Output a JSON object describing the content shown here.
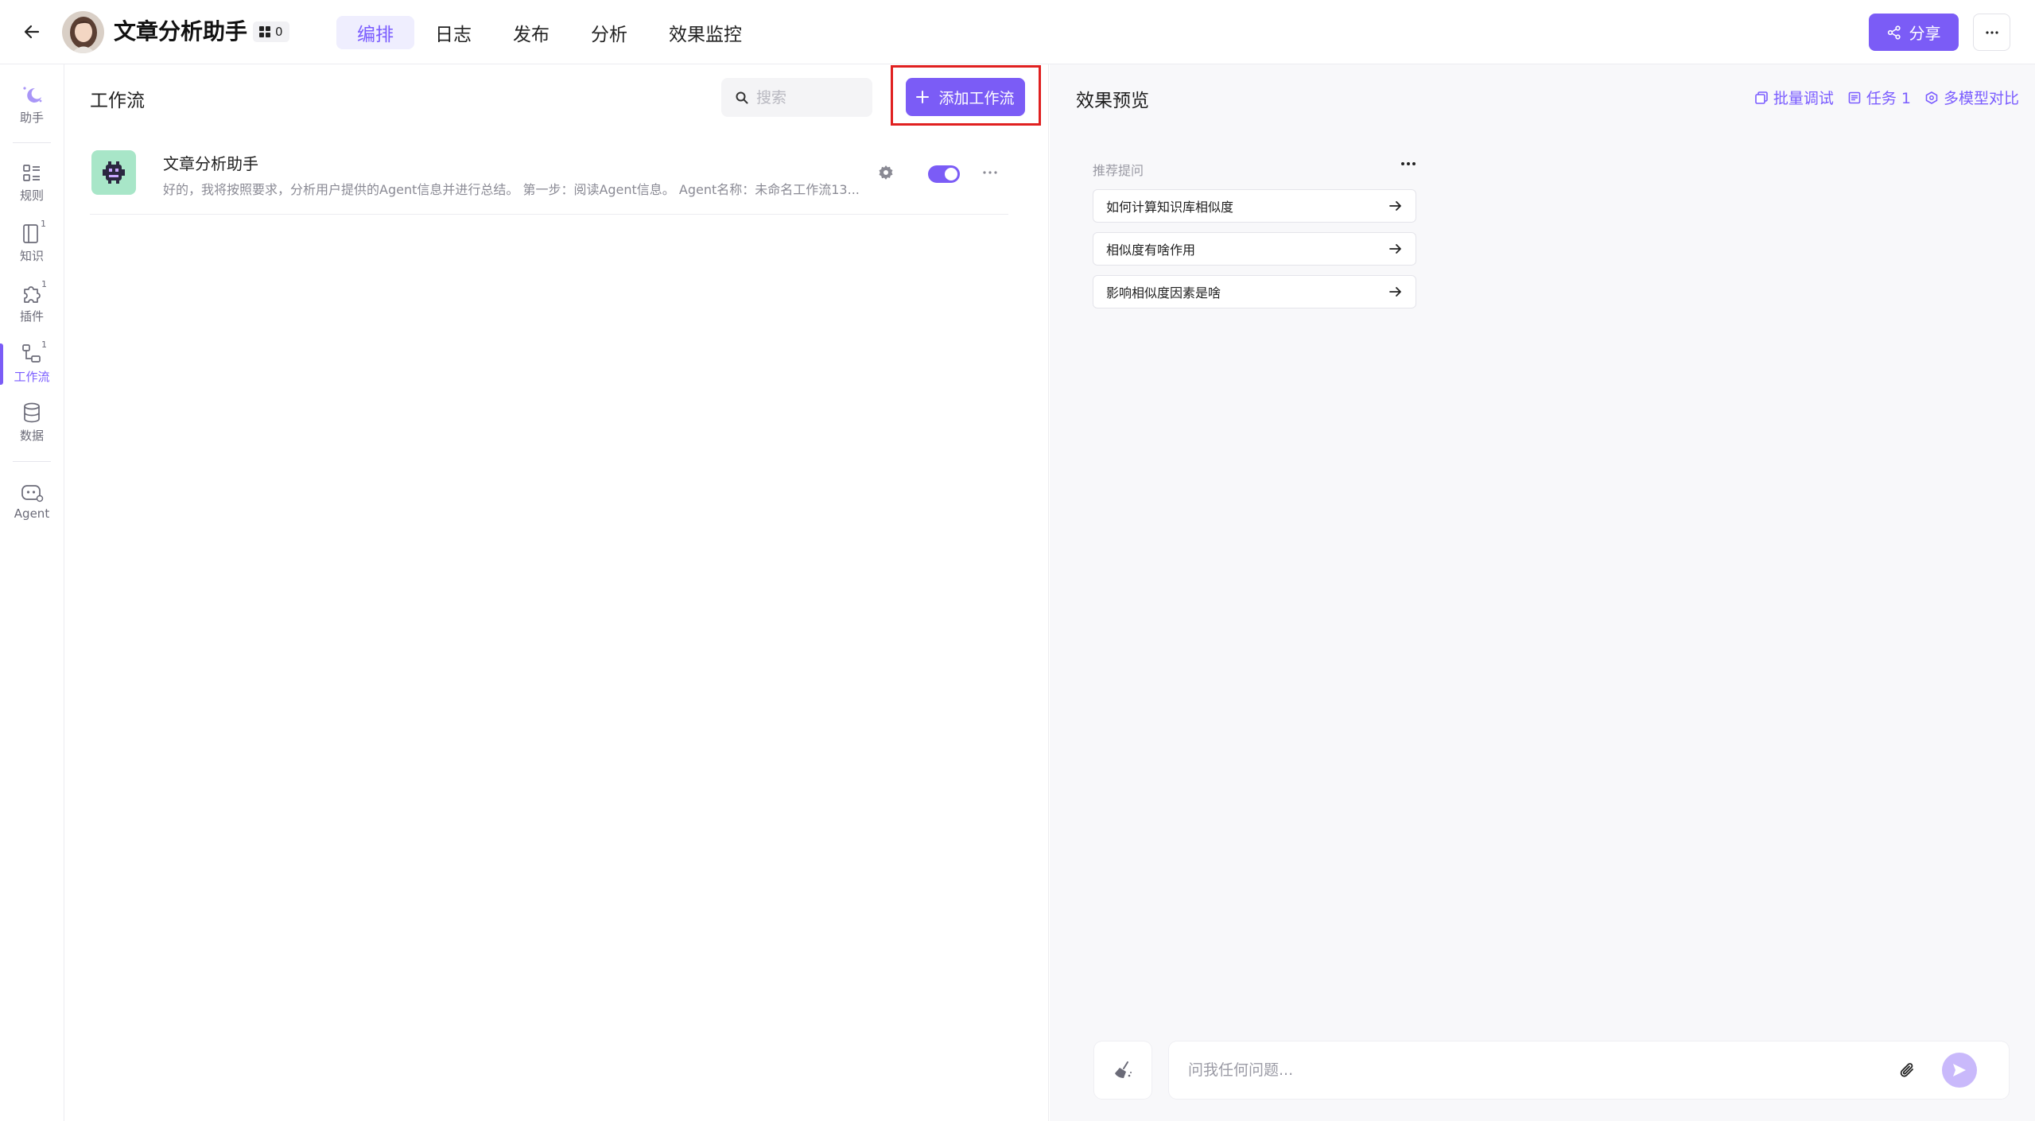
{
  "header": {
    "app_title": "文章分析助手",
    "badge_count": "0",
    "tabs": [
      {
        "label": "编排",
        "active": true
      },
      {
        "label": "日志"
      },
      {
        "label": "发布"
      },
      {
        "label": "分析"
      },
      {
        "label": "效果监控"
      }
    ],
    "share_label": "分享",
    "accent_color": "#7b5cf6"
  },
  "sidebar": {
    "items": [
      {
        "label": "助手",
        "icon": "assistant-icon"
      },
      {
        "label": "规则",
        "icon": "rules-icon"
      },
      {
        "label": "知识",
        "icon": "knowledge-icon",
        "count": "1"
      },
      {
        "label": "插件",
        "icon": "plugin-icon",
        "count": "1"
      },
      {
        "label": "工作流",
        "icon": "workflow-icon",
        "count": "1",
        "active": true
      },
      {
        "label": "数据",
        "icon": "database-icon"
      },
      {
        "label": "Agent",
        "icon": "agent-icon"
      }
    ]
  },
  "workflow_panel": {
    "title": "工作流",
    "search_placeholder": "搜索",
    "add_label": "添加工作流",
    "items": [
      {
        "name": "文章分析助手",
        "description": "好的，我将按照要求，分析用户提供的Agent信息并进行总结。 第一步：阅读Agent信息。 Agent名称：未命名工作流13...",
        "enabled": true
      }
    ]
  },
  "preview_panel": {
    "title": "效果预览",
    "actions": [
      {
        "label": "批量调试",
        "icon": "batch-debug-icon"
      },
      {
        "label": "任务 1",
        "icon": "task-icon"
      },
      {
        "label": "多模型对比",
        "icon": "model-compare-icon"
      }
    ],
    "suggestions_label": "推荐提问",
    "suggestions": [
      "如何计算知识库相似度",
      "相似度有啥作用",
      "影响相似度因素是啥"
    ],
    "chat_placeholder": "问我任何问题..."
  }
}
